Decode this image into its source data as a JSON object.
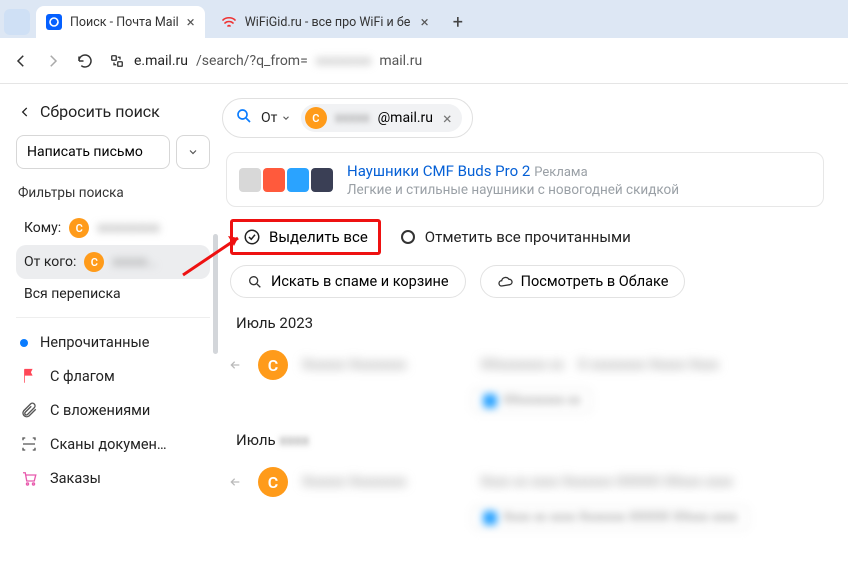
{
  "browser": {
    "tabs": [
      {
        "label": "Поиск - Почта Mail",
        "active": true,
        "favicon": "mailru"
      },
      {
        "label": "WiFiGid.ru - все про WiFi и бе",
        "active": false,
        "favicon": "wifi"
      }
    ],
    "url_prefix": "e.mail.ru",
    "url_mid": "/search/?q_from=",
    "url_suffix": "mail.ru"
  },
  "sidebar": {
    "reset": "Сбросить поиск",
    "compose": "Написать письмо",
    "filters_header": "Фильтры поиска",
    "to_label": "Кому:",
    "from_label": "От кого:",
    "all_thread": "Вся переписка",
    "items": {
      "unread": "Непрочитанные",
      "flagged": "С флагом",
      "attachments": "С вложениями",
      "scans": "Сканы докумен…",
      "orders": "Заказы"
    },
    "avatar_letter": "С"
  },
  "search": {
    "from_prefix": "От",
    "chip_email": "@mail.ru",
    "avatar_letter": "С"
  },
  "ad": {
    "title": "Наушники CMF Buds Pro 2",
    "badge": "Реклама",
    "subtitle": "Легкие и стильные наушники с новогодней скидкой"
  },
  "actions": {
    "select_all": "Выделить все",
    "mark_read": "Отметить все прочитанными",
    "search_spam": "Искать в спаме и корзине",
    "view_cloud": "Посмотреть в Облаке"
  },
  "groups": {
    "g1": "Июль 2023",
    "g2": "Июль"
  },
  "avatar_letter": "С"
}
